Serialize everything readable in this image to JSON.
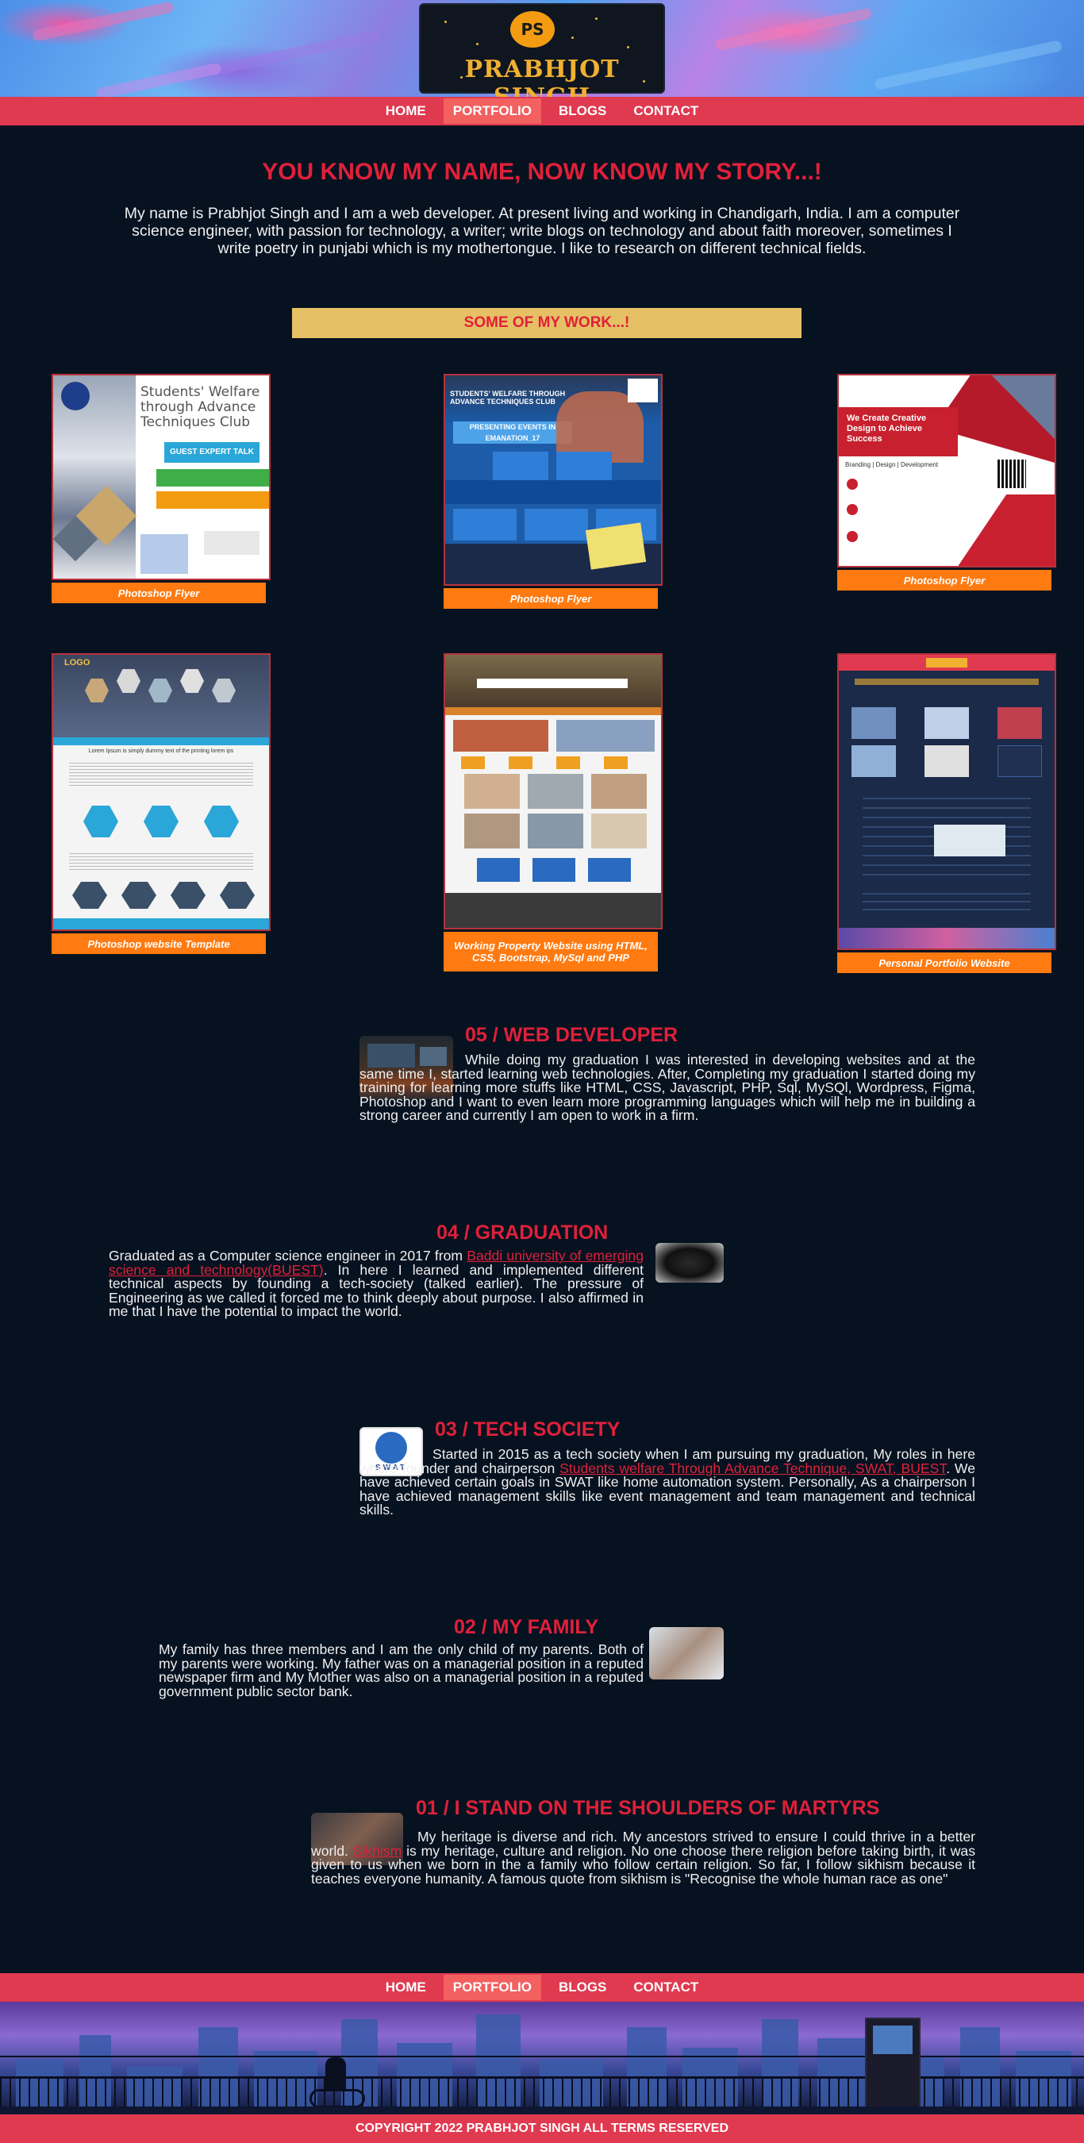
{
  "brand": {
    "initials": "PS",
    "name": "PRABHJOT SINGH"
  },
  "nav": {
    "home": "HOME",
    "portfolio": "PORTFOLIO",
    "blogs": "BLOGS",
    "contact": "CONTACT"
  },
  "story": {
    "title": "YOU KNOW MY NAME, NOW KNOW MY STORY...!",
    "intro": "My name is Prabhjot Singh and I am a web developer. At present living and working in Chandigarh, India. I am a computer science engineer, with passion for technology, a writer; write blogs on technology and about faith moreover, sometimes I write poetry in punjabi which is my mothertongue. I like to research on different technical fields."
  },
  "work": {
    "heading": "SOME OF MY WORK...!",
    "items": [
      {
        "caption": "Photoshop Flyer",
        "flyer_title": "Students' Welfare through Advance Techniques Club",
        "badge": "GUEST EXPERT TALK"
      },
      {
        "caption": "Photoshop Flyer",
        "flyer_title": "STUDENTS' WELFARE THROUGH ADVANCE TECHNIQUES CLUB",
        "badge": "PRESENTING EVENTS IN EMANATION_17"
      },
      {
        "caption": "Photoshop Flyer",
        "flyer_title": "We Create Creative Design to Achieve Success",
        "badge": "Branding | Design | Development"
      },
      {
        "caption": "Photoshop website Template",
        "flyer_title": "LOGO",
        "badge": "Lorem Ipsum is simply dummy text of the printing lorem ips"
      },
      {
        "caption": "Working Property Website using HTML, CSS, Bootstrap, MySql and PHP",
        "flyer_title": "",
        "badge": ""
      },
      {
        "caption": "Personal Portfolio Website",
        "flyer_title": "",
        "badge": ""
      }
    ]
  },
  "sections": {
    "web": {
      "title": "05 / WEB DEVELOPER",
      "text": "While doing my graduation I was interested in developing websites and at the same time I, started learning web technologies. After, Completing my graduation I started doing my training for learning more stuffs like HTML, CSS, Javascript, PHP, Sql, MySQl, Wordpress, Figma, Photoshop and I want to even learn more programming languages which will help me in building a strong career and currently I am open to work in a firm."
    },
    "grad": {
      "title": "04 / GRADUATION",
      "text_a": "Graduated as a Computer science engineer in 2017 from ",
      "link": "Baddi university of emerging science and technology(BUEST)",
      "text_b": ". In here I learned and implemented different technical aspects by founding a tech-society (talked earlier). The pressure of Engineering as we called it forced me to think deeply about purpose. I also affirmed in me that I have the potential to impact the world."
    },
    "tech": {
      "title": "03 / TECH SOCIETY",
      "logo_text": "SWAT",
      "text_a": "Started in 2015 as a tech society when I am pursuing my graduation, My roles in here where founder and chairperson ",
      "link": "Students welfare Through Advance Technique, SWAT, BUEST",
      "text_b": ". We have achieved certain goals in SWAT like home automation system. Personally, As a chairperson I have achieved management skills like event management and team management and technical skills."
    },
    "family": {
      "title": "02 / MY FAMILY",
      "text": "My family has three members and I am the only child of my parents. Both of my parents were working. My father was on a managerial position in a reputed newspaper firm and My Mother was also on a managerial position in a reputed government public sector bank."
    },
    "martyrs": {
      "title": "01 / I STAND ON THE SHOULDERS OF MARTYRS",
      "text_a": "My heritage is diverse and rich. My ancestors strived to ensure I could thrive in a better world. ",
      "link": "Sikhism",
      "text_b": " is my heritage, culture and religion. No one choose there religion before taking birth, it was given to us when we born in the a family who follow certain religion. So far, I follow sikhism because it teaches everyone humanity. A famous quote from sikhism is \"Recognise the whole human race as one\""
    }
  },
  "footer": {
    "copyright": "COPYRIGHT 2022 PRABHJOT SINGH ALL TERMS RESERVED"
  },
  "colors": {
    "accent": "#e0203a",
    "nav": "#e03a50",
    "caption": "#ff7a10",
    "background": "#061220",
    "work_bar": "#e6c064"
  }
}
